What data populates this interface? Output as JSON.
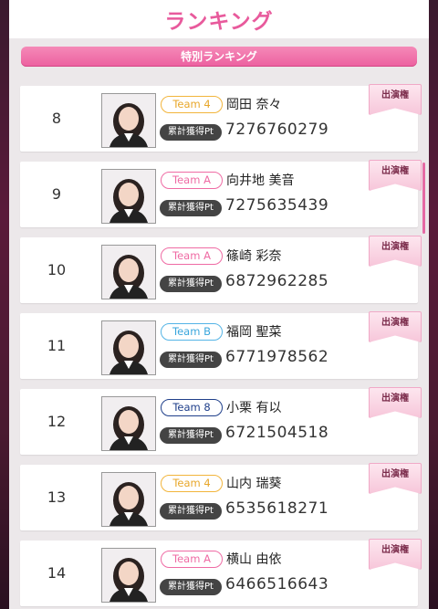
{
  "header": {
    "title": "ランキング"
  },
  "subtitle": "特別ランキング",
  "colors": {
    "accent": "#e85a9c",
    "team_a": "#ef6ba4",
    "team_4": "#f2b53c",
    "team_b": "#55b4e6",
    "team_8": "#1f3f8a"
  },
  "pt_label": "累計獲得Pt",
  "appear_label": "出演権",
  "rows": [
    {
      "rank": "8",
      "team": "Team 4",
      "team_class": "t4",
      "name": "岡田 奈々",
      "points": "7276760279"
    },
    {
      "rank": "9",
      "team": "Team A",
      "team_class": "ta",
      "name": "向井地 美音",
      "points": "7275635439"
    },
    {
      "rank": "10",
      "team": "Team A",
      "team_class": "ta",
      "name": "篠崎 彩奈",
      "points": "6872962285"
    },
    {
      "rank": "11",
      "team": "Team B",
      "team_class": "tb",
      "name": "福岡 聖菜",
      "points": "6771978562"
    },
    {
      "rank": "12",
      "team": "Team 8",
      "team_class": "t8",
      "name": "小栗 有以",
      "points": "6721504518"
    },
    {
      "rank": "13",
      "team": "Team 4",
      "team_class": "t4",
      "name": "山内 瑞葵",
      "points": "6535618271"
    },
    {
      "rank": "14",
      "team": "Team A",
      "team_class": "ta",
      "name": "横山 由依",
      "points": "6466516643"
    }
  ]
}
